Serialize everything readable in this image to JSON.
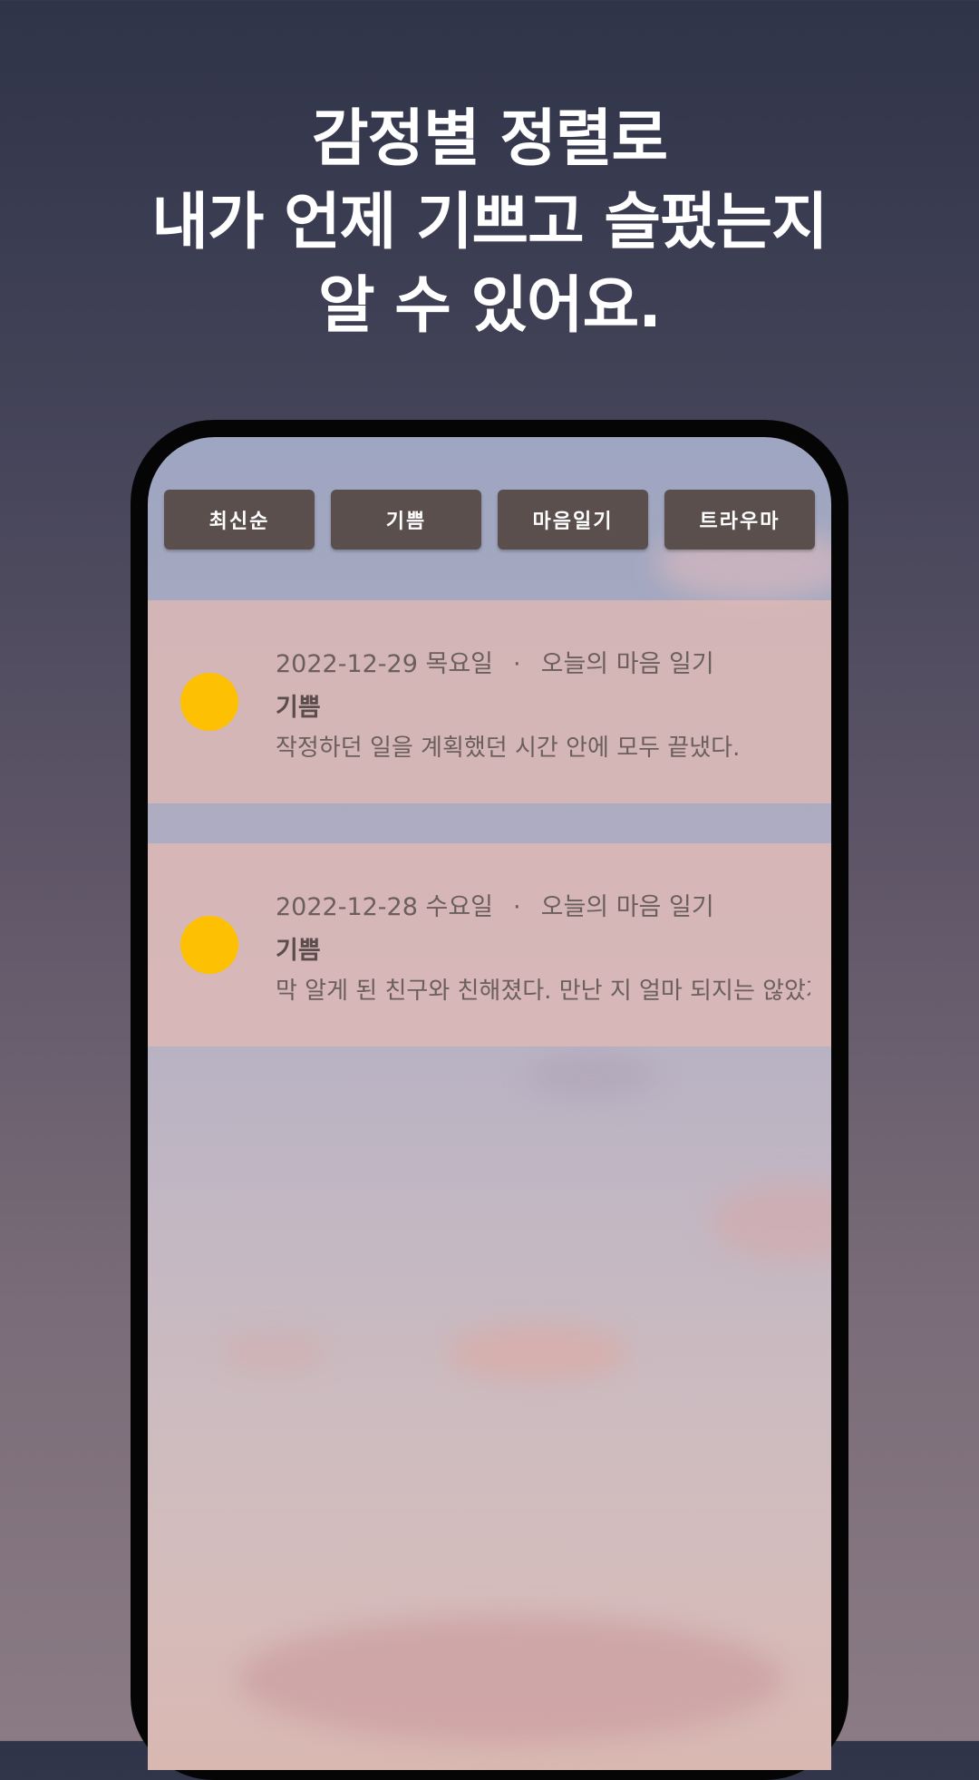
{
  "headline": {
    "line1": "감정별 정렬로",
    "line2": "내가 언제 기쁘고 슬펐는지",
    "line3": "알 수 있어요."
  },
  "filters": [
    {
      "label": "최신순"
    },
    {
      "label": "기쁨"
    },
    {
      "label": "마음일기"
    },
    {
      "label": "트라우마"
    }
  ],
  "entries": [
    {
      "date": "2022-12-29 목요일",
      "separator": "·",
      "category": "오늘의 마음 일기",
      "emotion": "기쁨",
      "text": "작정하던 일을 계획했던 시간 안에 모두 끝냈다.",
      "dot_color": "#fdc002"
    },
    {
      "date": "2022-12-28 수요일",
      "separator": "·",
      "category": "오늘의 마음 일기",
      "emotion": "기쁨",
      "text": "막 알게 된 친구와 친해졌다. 만난 지 얼마 되지는 않았지만",
      "dot_color": "#fdc002"
    }
  ],
  "colors": {
    "button_bg": "#5b4f4e",
    "entry_bg": "#deb8b4",
    "emotion_dot": "#fdc002"
  }
}
